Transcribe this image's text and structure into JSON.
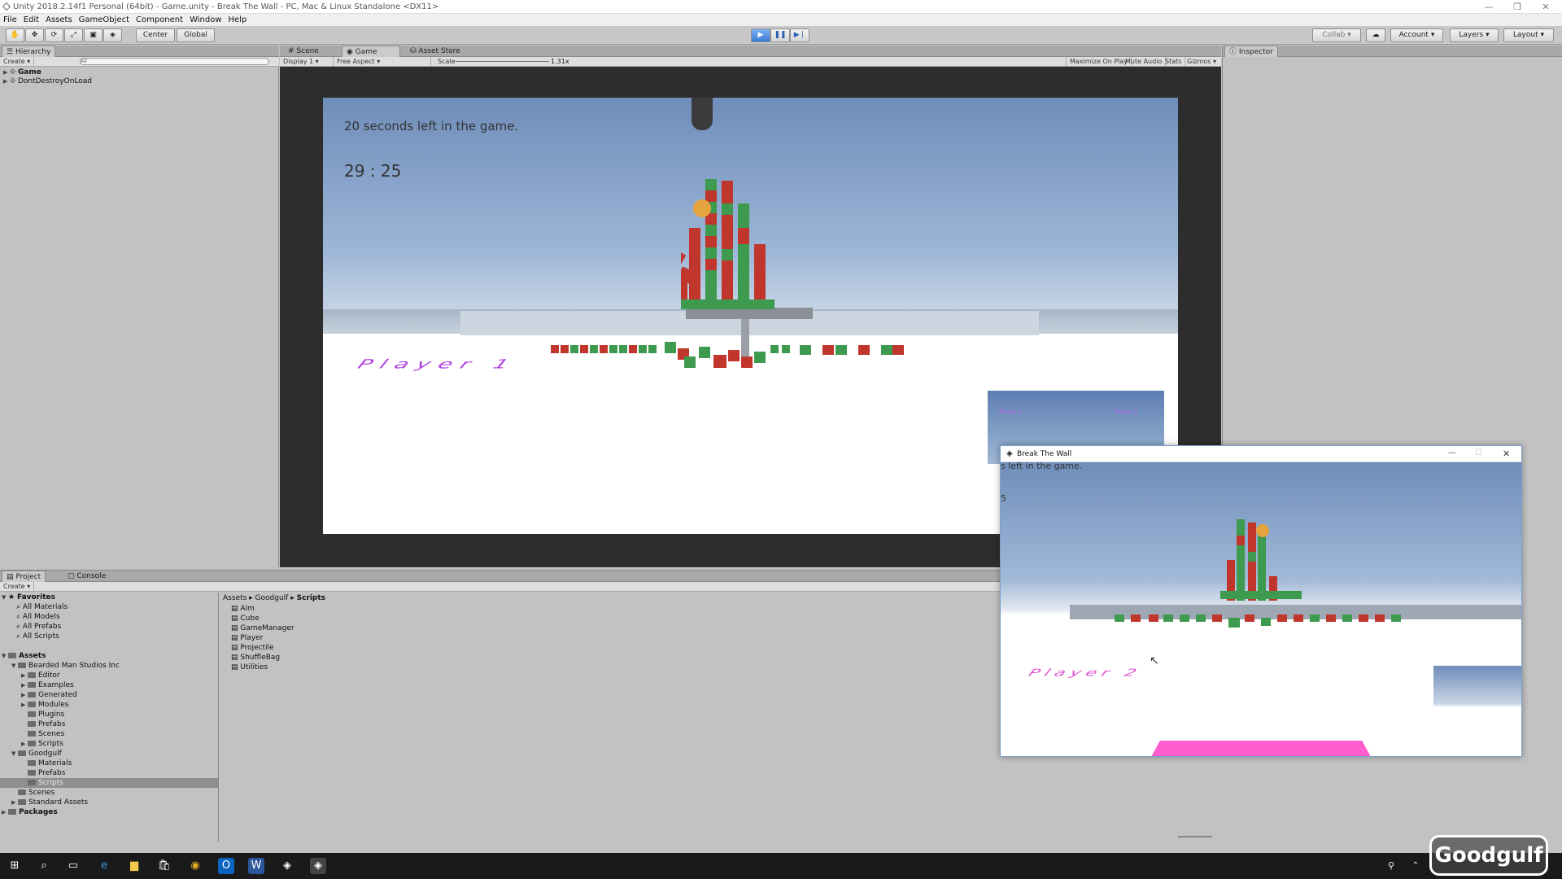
{
  "window": {
    "title": "Unity 2018.2.14f1 Personal (64bit) - Game.unity - Break The Wall - PC, Mac & Linux Standalone <DX11>"
  },
  "menu": [
    "File",
    "Edit",
    "Assets",
    "GameObject",
    "Component",
    "Window",
    "Help"
  ],
  "toolbar": {
    "center": "Center",
    "global": "Global",
    "collab": "Collab",
    "account": "Account",
    "layers": "Layers",
    "layout": "Layout"
  },
  "hierarchy": {
    "tab": "Hierarchy",
    "create": "Create",
    "search_placeholder": "All",
    "items": [
      "Game",
      "DontDestroyOnLoad"
    ]
  },
  "view_tabs": [
    "Scene",
    "Game",
    "Asset Store"
  ],
  "game_bar": {
    "display": "Display 1",
    "aspect": "Free Aspect",
    "scale_label": "Scale",
    "scale_value": "1.31x",
    "maximize": "Maximize On Play",
    "mute": "Mute Audio",
    "stats": "Stats",
    "gizmos": "Gizmos"
  },
  "inspector": {
    "tab": "Inspector"
  },
  "game": {
    "timer_text": "20 seconds left in the game.",
    "score": "29 : 25",
    "player1": "Player 1",
    "mini_p1": "Player 1",
    "mini_p2": "Player 2"
  },
  "build_window": {
    "title": "Break The Wall",
    "timer_text": "s left in the game.",
    "score_fragment": "5",
    "player2": "Player 2"
  },
  "project": {
    "tabs": [
      "Project",
      "Console"
    ],
    "create": "Create",
    "favorites_label": "Favorites",
    "favorites": [
      "All Materials",
      "All Models",
      "All Prefabs",
      "All Scripts"
    ],
    "assets_label": "Assets",
    "tree": [
      {
        "label": "Bearded Man Studios Inc",
        "depth": 1,
        "arrow": "▼"
      },
      {
        "label": "Editor",
        "depth": 2,
        "arrow": "▶"
      },
      {
        "label": "Examples",
        "depth": 2,
        "arrow": "▶"
      },
      {
        "label": "Generated",
        "depth": 2,
        "arrow": "▶"
      },
      {
        "label": "Modules",
        "depth": 2,
        "arrow": "▶"
      },
      {
        "label": "Plugins",
        "depth": 2,
        "arrow": ""
      },
      {
        "label": "Prefabs",
        "depth": 2,
        "arrow": ""
      },
      {
        "label": "Scenes",
        "depth": 2,
        "arrow": ""
      },
      {
        "label": "Scripts",
        "depth": 2,
        "arrow": "▶"
      },
      {
        "label": "Goodgulf",
        "depth": 1,
        "arrow": "▼"
      },
      {
        "label": "Materials",
        "depth": 2,
        "arrow": ""
      },
      {
        "label": "Prefabs",
        "depth": 2,
        "arrow": ""
      },
      {
        "label": "Scripts",
        "depth": 2,
        "arrow": "",
        "selected": true
      },
      {
        "label": "Scenes",
        "depth": 1,
        "arrow": ""
      },
      {
        "label": "Standard Assets",
        "depth": 1,
        "arrow": "▶"
      }
    ],
    "packages_label": "Packages",
    "breadcrumb": [
      "Assets",
      "Goodgulf",
      "Scripts"
    ],
    "scripts": [
      "Aim",
      "Cube",
      "GameManager",
      "Player",
      "Projectile",
      "ShuffleBag",
      "Utilities"
    ]
  },
  "watermark": "Goodgulf",
  "colors": {
    "accent_play": "#3a7bd5",
    "player_text": "#b040e0",
    "red_cube": "#c0362c",
    "green_cube": "#3e9a4e",
    "pink_platform": "#ff5ccd"
  }
}
